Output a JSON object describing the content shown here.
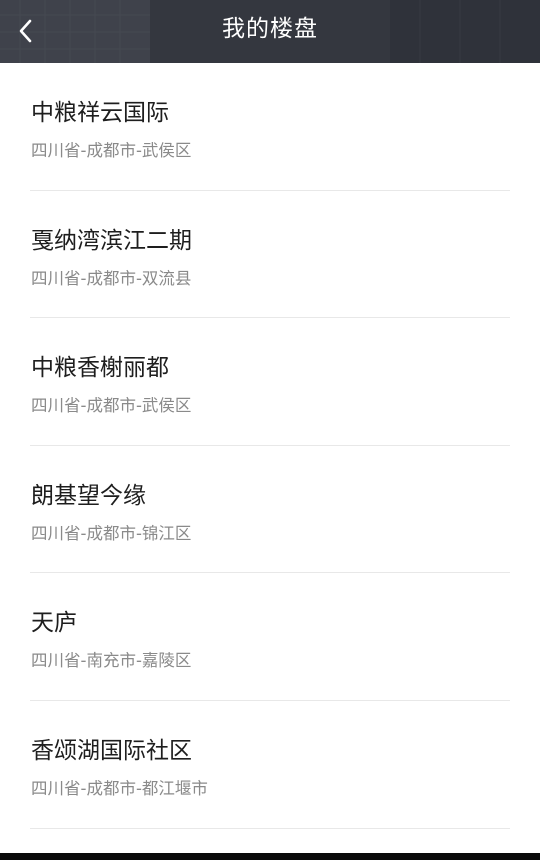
{
  "header": {
    "title": "我的楼盘",
    "back_icon": "chevron-left-icon",
    "background_color": "#33363f",
    "title_color": "#ffffff"
  },
  "properties": [
    {
      "name": "中粮祥云国际",
      "address": "四川省-成都市-武侯区"
    },
    {
      "name": "戛纳湾滨江二期",
      "address": "四川省-成都市-双流县"
    },
    {
      "name": "中粮香榭丽都",
      "address": "四川省-成都市-武侯区"
    },
    {
      "name": "朗基望今缘",
      "address": "四川省-成都市-锦江区"
    },
    {
      "name": "天庐",
      "address": "四川省-南充市-嘉陵区"
    },
    {
      "name": "香颂湖国际社区",
      "address": "四川省-成都市-都江堰市"
    }
  ],
  "colors": {
    "name_text": "#1e1e1e",
    "address_text": "#8a8a8a",
    "divider": "#e8e8e8"
  }
}
